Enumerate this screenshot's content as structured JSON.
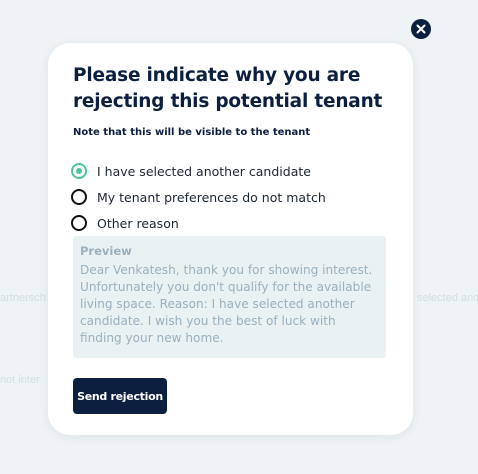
{
  "background": {
    "left_fragment_1": "artnersch",
    "left_fragment_2": "not inter",
    "right_fragment_1": "selected ande"
  },
  "modal": {
    "title": "Please indicate why you are rejecting this potential tenant",
    "note": "Note that this will be visible to the tenant",
    "options": [
      {
        "label": "I have selected another candidate",
        "checked": true
      },
      {
        "label": "My tenant preferences do not match",
        "checked": false
      },
      {
        "label": "Other reason",
        "checked": false
      }
    ],
    "preview": {
      "label": "Preview",
      "text": "Dear Venkatesh, thank you for showing interest. Unfortunately you don't qualify for the available living space. Reason: I have selected another candidate. I wish you the best of luck with finding your new home."
    },
    "send_button_label": "Send rejection"
  },
  "icons": {
    "close": "close-icon"
  },
  "colors": {
    "navy": "#0c1f3f",
    "accent_green": "#4ac59a",
    "preview_bg": "#e9f1f2",
    "preview_text": "#9ab0bd",
    "backdrop": "#eef4f5"
  }
}
